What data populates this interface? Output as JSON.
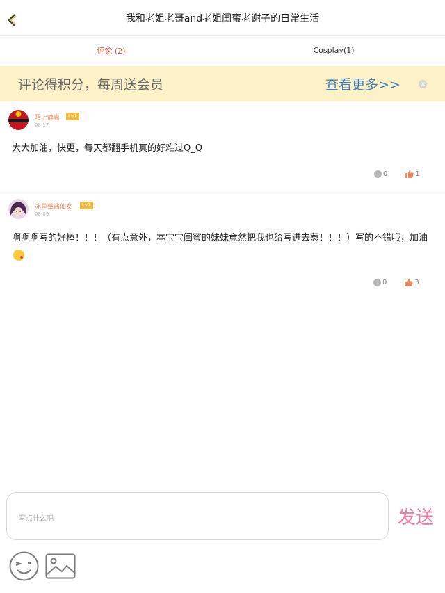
{
  "header": {
    "title": "我和老姐老哥and老姐闺蜜老谢子的日常生活",
    "back_icon": "chevron-left-icon"
  },
  "tabs": [
    {
      "label": "评论 (2)",
      "active": true
    },
    {
      "label": "Cosplay(1)",
      "active": false
    }
  ],
  "banner": {
    "text": "评论得积分，每周送会员",
    "link": "查看更多>>",
    "close_icon": "close-circle-icon"
  },
  "comments": [
    {
      "username": "陌上静嘉",
      "level": "Lv1",
      "date": "08-17",
      "text": "大大加油，快更，每天都翻手机真的好难过Q_Q",
      "replies": "0",
      "likes": "1"
    },
    {
      "username": "冰草莓酱仙女",
      "level": "Lv1",
      "date": "08-09",
      "text": "啊啊啊写的好棒！！！（有点意外，本宝宝闺蜜的妹妹竟然把我也给写进去惹！！！）写的不错哦，加油",
      "replies": "0",
      "likes": "3"
    }
  ],
  "composer": {
    "placeholder": "写点什么吧",
    "send_label": "发送",
    "emoji_icon": "smiley-wink-icon",
    "image_icon": "image-icon"
  },
  "colors": {
    "accent_tab": "#e0573b",
    "banner_bg": "#fdf1c8",
    "link": "#3f7fb4",
    "send": "#f07aa0",
    "username": "#e98a5f",
    "level_badge": "#f5b940"
  }
}
